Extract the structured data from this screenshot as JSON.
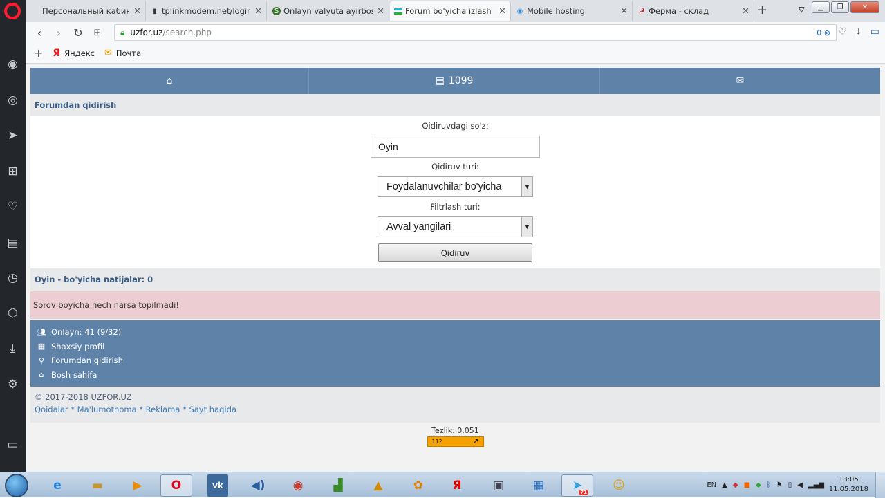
{
  "browser": {
    "tabs": [
      {
        "title": "Персональный кабинет",
        "icon": "none"
      },
      {
        "title": "tplinkmodem.net/login_s",
        "icon": "page-icon"
      },
      {
        "title": "Onlayn valyuta ayirboshl",
        "icon": "currency-icon"
      },
      {
        "title": "Forum bo'yicha izlash",
        "icon": "flag-uz-icon"
      },
      {
        "title": "Mobile hosting",
        "icon": "hosting-icon"
      },
      {
        "title": "Ферма - склад",
        "icon": "hammer-sickle-icon"
      }
    ],
    "active_tab": 3,
    "url_host": "uzfor.uz",
    "url_path": "/search.php",
    "adblock_count": "0",
    "bookmarks": [
      {
        "label": "Яндекс",
        "icon": "yandex-icon"
      },
      {
        "label": "Почта",
        "icon": "mail-icon"
      }
    ]
  },
  "site": {
    "nav_count": "1099",
    "search_heading": "Forumdan qidirish",
    "search_label": "Qidiruvdagi so'z:",
    "search_value": "Oyin",
    "type_label": "Qidiruv turi:",
    "type_value": "Foydalanuvchilar bo'yicha",
    "filter_label": "Filtrlash turi:",
    "filter_value": "Avval yangilari",
    "search_button": "Qidiruv",
    "results_heading": "Oyin - bo'yicha natijalar: 0",
    "no_results": "Sorov boyicha hech narsa topilmadi!",
    "footer_nav": [
      {
        "label": "Onlayn: 41 (9/32)",
        "icon": "users-icon"
      },
      {
        "label": "Shaxsiy profil",
        "icon": "grid-icon"
      },
      {
        "label": "Forumdan qidirish",
        "icon": "search-icon"
      },
      {
        "label": "Bosh sahifa",
        "icon": "home-icon"
      }
    ],
    "copyright": "© 2017-2018 UZFOR.UZ",
    "footer_links": [
      "Qoidalar",
      "Ma'lumotnoma",
      "Reklama",
      "Sayt haqida"
    ],
    "speed": "Tezlik: 0.051",
    "counter": "112"
  },
  "taskbar": {
    "lang": "EN",
    "time": "13:05",
    "date": "11.05.2018",
    "telegram_badge": "71"
  },
  "colors": {
    "nav_blue": "#5f82a9",
    "alert_pink": "#ebcdd2",
    "opera_red": "#ff1b2d"
  }
}
